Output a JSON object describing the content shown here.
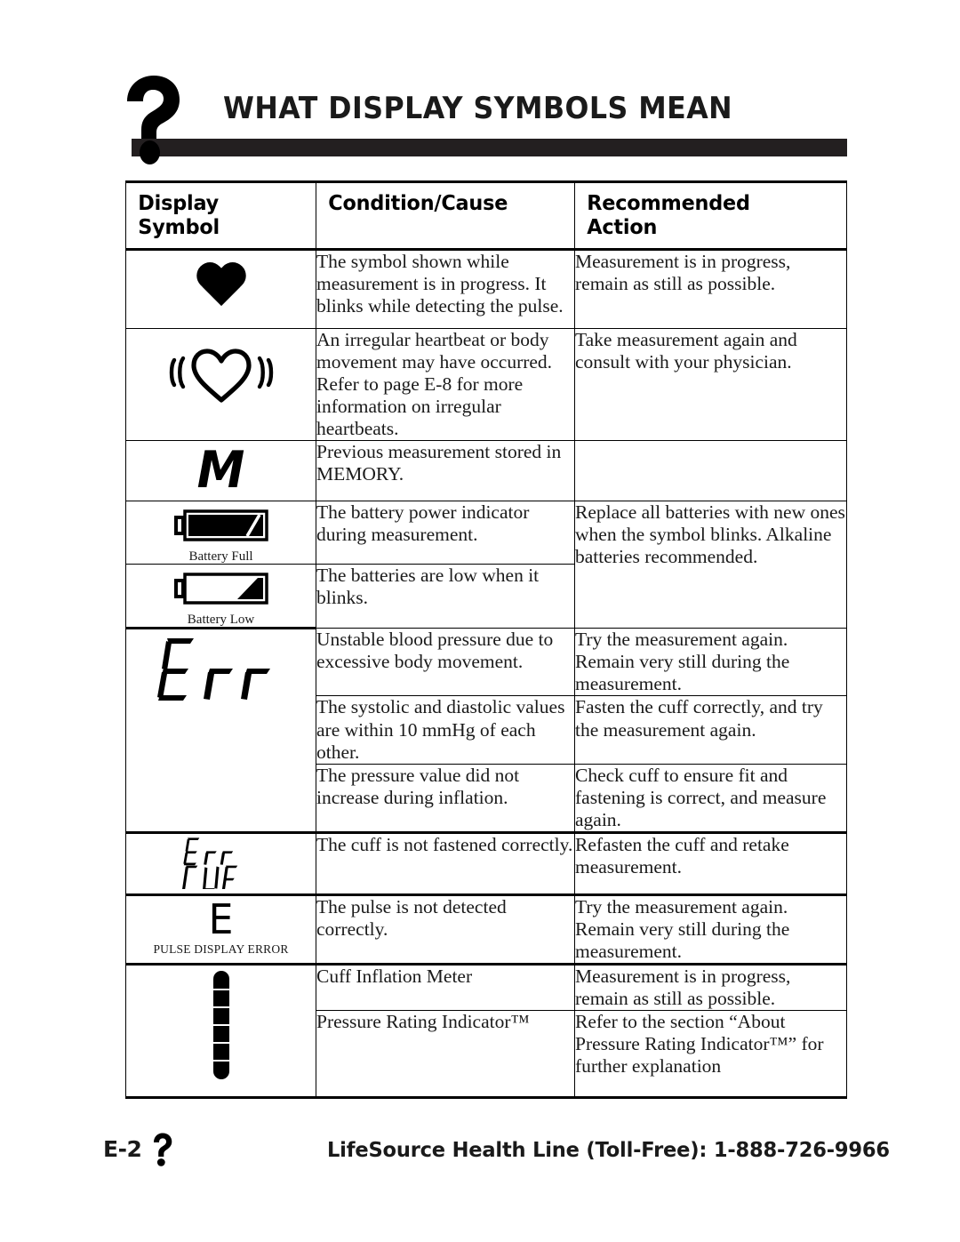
{
  "header": {
    "title": "WHAT DISPLAY SYMBOLS MEAN",
    "icon": "question-mark-icon"
  },
  "table": {
    "columns": [
      {
        "id": "display_symbol",
        "label": "Display\nSymbol"
      },
      {
        "id": "condition_cause",
        "label": "Condition/Cause"
      },
      {
        "id": "recommended_action",
        "label": "Recommended\nAction"
      }
    ],
    "headers": {
      "display_symbol_line1": "Display",
      "display_symbol_line2": "Symbol",
      "condition_cause": "Condition/Cause",
      "recommended_action_line1": "Recommended",
      "recommended_action_line2": "Action"
    },
    "rows": [
      {
        "symbol": "heart-filled-icon",
        "symbol_caption": "",
        "condition": "The symbol shown while measurement is in progress. It blinks while detecting the pulse.",
        "action": "Measurement is in progress, remain as still as possible."
      },
      {
        "symbol": "irregular-heartbeat-icon",
        "symbol_caption": "",
        "condition": "An irregular heartbeat or body movement may have occurred. Refer to page E-8 for more information on irregular heartbeats.",
        "action": "Take measurement again and consult with your physician."
      },
      {
        "symbol": "memory-m-icon",
        "symbol_caption": "",
        "condition": "Previous measurement stored in MEMORY.",
        "action": ""
      },
      {
        "symbol": "battery-full-icon",
        "symbol_caption": "Battery Full",
        "condition": "The battery power indicator during measurement.",
        "action": "Replace all batteries with new ones when the symbol blinks. Alkaline batteries recommended."
      },
      {
        "symbol": "battery-low-icon",
        "symbol_caption": "Battery Low",
        "condition": "The batteries are low when it blinks.",
        "action": ""
      },
      {
        "symbol": "err-lcd-icon",
        "symbol_caption": "",
        "condition": "Unstable blood pressure due to excessive body movement.",
        "action": "Try the measurement again. Remain very still during the measurement."
      },
      {
        "symbol": "",
        "symbol_caption": "",
        "condition": "The systolic and diastolic values are within 10 mmHg of each other.",
        "action": "Fasten the cuff correctly, and try the measurement again."
      },
      {
        "symbol": "",
        "symbol_caption": "",
        "condition": "The pressure value did not increase during inflation.",
        "action": "Check cuff to ensure fit and fastening is correct, and measure again."
      },
      {
        "symbol": "err-cuf-lcd-icon",
        "symbol_caption": "",
        "condition": "The cuff is not fastened correctly.",
        "action": "Refasten the cuff and retake measurement."
      },
      {
        "symbol": "pulse-e-icon",
        "symbol_caption": "PULSE DISPLAY ERROR",
        "condition": "The pulse is not detected correctly.",
        "action": "Try the measurement again. Remain very still during the measurement."
      },
      {
        "symbol": "cuff-inflation-bar-icon",
        "symbol_caption": "",
        "condition": "Cuff Inflation Meter",
        "action": "Measurement is in progress, remain as still as possible."
      },
      {
        "symbol": "",
        "symbol_caption": "",
        "condition": "Pressure Rating Indicator™",
        "action": "Refer to the section “About Pressure Rating Indicator™” for further explanation"
      }
    ],
    "lcd_text": {
      "err": "Err",
      "err_cuf_line1": "Err",
      "err_cuf_line2": "CUF",
      "memory": "M",
      "pulse_error": "E"
    }
  },
  "footer": {
    "page_number": "E-2",
    "icon": "question-mark-icon",
    "help_line": "LifeSource Health Line (Toll-Free): 1-888-726-9966"
  },
  "colors": {
    "ink": "#000000",
    "rule": "#231f20",
    "body_text": "#1a1a1a",
    "background": "#ffffff"
  }
}
